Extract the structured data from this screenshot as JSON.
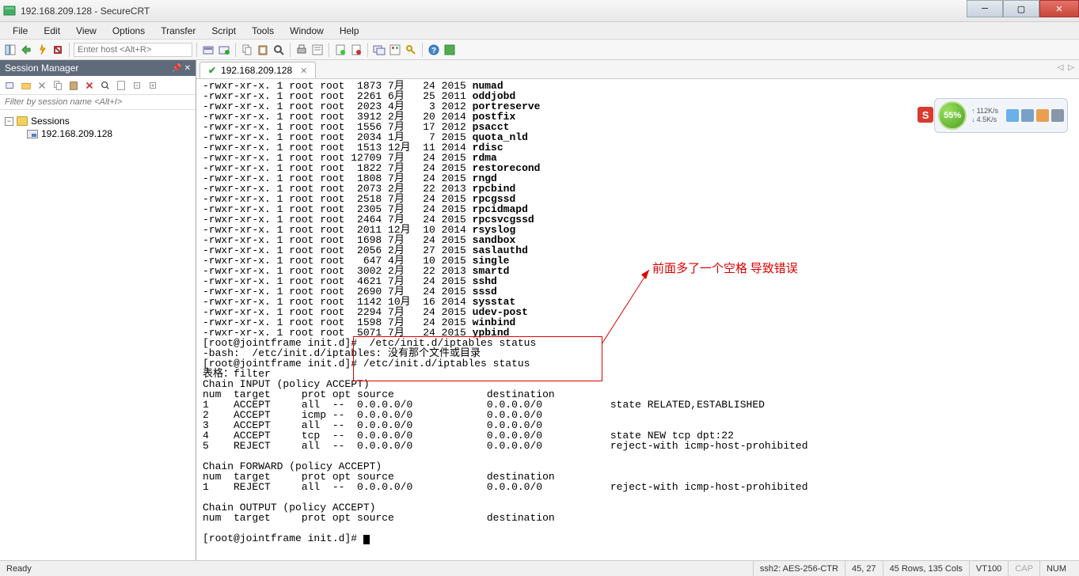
{
  "window": {
    "title": "192.168.209.128 - SecureCRT"
  },
  "menu": [
    "File",
    "Edit",
    "View",
    "Options",
    "Transfer",
    "Script",
    "Tools",
    "Window",
    "Help"
  ],
  "toolbar": {
    "host_placeholder": "Enter host <Alt+R>"
  },
  "session_manager": {
    "title": "Session Manager",
    "filter_placeholder": "Filter by session name <Alt+I>",
    "root": "Sessions",
    "items": [
      "192.168.209.128"
    ]
  },
  "tab": {
    "label": "192.168.209.128"
  },
  "annotation": {
    "text": "前面多了一个空格  导致错误"
  },
  "widget": {
    "percent": "55%",
    "up": "112K/s",
    "down": "4.5K/s",
    "badge": "S"
  },
  "statusbar": {
    "ready": "Ready",
    "ssh": "ssh2: AES-256-CTR",
    "pos": "45,  27",
    "dims": "45 Rows, 135 Cols",
    "term": "VT100",
    "cap": "CAP",
    "num": "NUM"
  },
  "terminal": {
    "ls": [
      {
        "perm": "-rwxr-xr-x. 1 root root  1873 7月   24 2015 ",
        "name": "numad"
      },
      {
        "perm": "-rwxr-xr-x. 1 root root  2261 6月   25 2011 ",
        "name": "oddjobd"
      },
      {
        "perm": "-rwxr-xr-x. 1 root root  2023 4月    3 2012 ",
        "name": "portreserve"
      },
      {
        "perm": "-rwxr-xr-x. 1 root root  3912 2月   20 2014 ",
        "name": "postfix"
      },
      {
        "perm": "-rwxr-xr-x. 1 root root  1556 7月   17 2012 ",
        "name": "psacct"
      },
      {
        "perm": "-rwxr-xr-x. 1 root root  2034 1月    7 2015 ",
        "name": "quota_nld"
      },
      {
        "perm": "-rwxr-xr-x. 1 root root  1513 12月  11 2014 ",
        "name": "rdisc"
      },
      {
        "perm": "-rwxr-xr-x. 1 root root 12709 7月   24 2015 ",
        "name": "rdma"
      },
      {
        "perm": "-rwxr-xr-x. 1 root root  1822 7月   24 2015 ",
        "name": "restorecond"
      },
      {
        "perm": "-rwxr-xr-x. 1 root root  1808 7月   24 2015 ",
        "name": "rngd"
      },
      {
        "perm": "-rwxr-xr-x. 1 root root  2073 2月   22 2013 ",
        "name": "rpcbind"
      },
      {
        "perm": "-rwxr-xr-x. 1 root root  2518 7月   24 2015 ",
        "name": "rpcgssd"
      },
      {
        "perm": "-rwxr-xr-x. 1 root root  2305 7月   24 2015 ",
        "name": "rpcidmapd"
      },
      {
        "perm": "-rwxr-xr-x. 1 root root  2464 7月   24 2015 ",
        "name": "rpcsvcgssd"
      },
      {
        "perm": "-rwxr-xr-x. 1 root root  2011 12月  10 2014 ",
        "name": "rsyslog"
      },
      {
        "perm": "-rwxr-xr-x. 1 root root  1698 7月   24 2015 ",
        "name": "sandbox"
      },
      {
        "perm": "-rwxr-xr-x. 1 root root  2056 2月   27 2015 ",
        "name": "saslauthd"
      },
      {
        "perm": "-rwxr-xr-x. 1 root root   647 4月   10 2015 ",
        "name": "single"
      },
      {
        "perm": "-rwxr-xr-x. 1 root root  3002 2月   22 2013 ",
        "name": "smartd"
      },
      {
        "perm": "-rwxr-xr-x. 1 root root  4621 7月   24 2015 ",
        "name": "sshd"
      },
      {
        "perm": "-rwxr-xr-x. 1 root root  2690 7月   24 2015 ",
        "name": "sssd"
      },
      {
        "perm": "-rwxr-xr-x. 1 root root  1142 10月  16 2014 ",
        "name": "sysstat"
      },
      {
        "perm": "-rwxr-xr-x. 1 root root  2294 7月   24 2015 ",
        "name": "udev-post"
      },
      {
        "perm": "-rwxr-xr-x. 1 root root  1598 7月   24 2015 ",
        "name": "winbind"
      },
      {
        "perm": "-rwxr-xr-x. 1 root root  5071 7月   24 2015 ",
        "name": "ypbind"
      }
    ],
    "cmd1_prompt": "[root@jointframe init.d]# ",
    "cmd1": " /etc/init.d/iptables status",
    "err": "-bash:  /etc/init.d/iptables: 没有那个文件或目录",
    "cmd2_prompt": "[root@jointframe init.d]# ",
    "cmd2": "/etc/init.d/iptables status",
    "out": [
      "表格：filter",
      "Chain INPUT (policy ACCEPT)",
      "num  target     prot opt source               destination         ",
      "1    ACCEPT     all  --  0.0.0.0/0            0.0.0.0/0           state RELATED,ESTABLISHED ",
      "2    ACCEPT     icmp --  0.0.0.0/0            0.0.0.0/0           ",
      "3    ACCEPT     all  --  0.0.0.0/0            0.0.0.0/0           ",
      "4    ACCEPT     tcp  --  0.0.0.0/0            0.0.0.0/0           state NEW tcp dpt:22 ",
      "5    REJECT     all  --  0.0.0.0/0            0.0.0.0/0           reject-with icmp-host-prohibited ",
      "",
      "Chain FORWARD (policy ACCEPT)",
      "num  target     prot opt source               destination         ",
      "1    REJECT     all  --  0.0.0.0/0            0.0.0.0/0           reject-with icmp-host-prohibited ",
      "",
      "Chain OUTPUT (policy ACCEPT)",
      "num  target     prot opt source               destination         "
    ],
    "final_prompt": "[root@jointframe init.d]# "
  }
}
